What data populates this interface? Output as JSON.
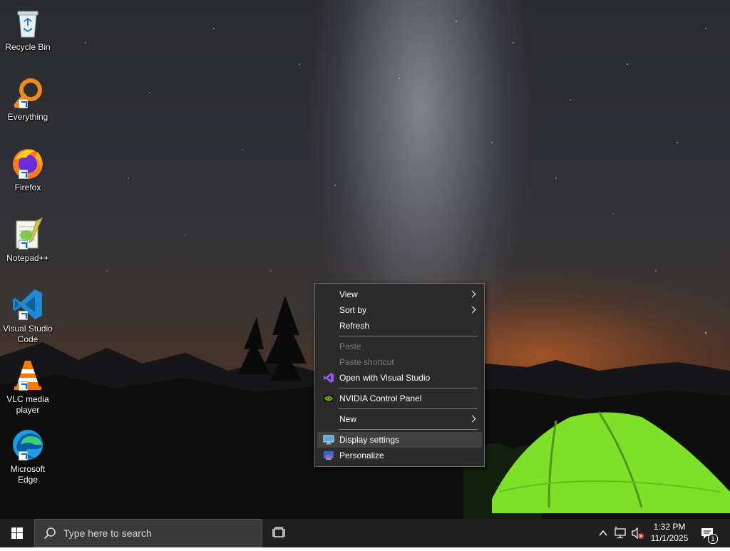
{
  "desktop": {
    "icons": [
      {
        "label": "Recycle Bin",
        "icon": "recycle-bin-icon"
      },
      {
        "label": "Everything",
        "icon": "everything-search-icon"
      },
      {
        "label": "Firefox",
        "icon": "firefox-icon"
      },
      {
        "label": "Notepad++",
        "icon": "notepadpp-icon"
      },
      {
        "label": "Visual Studio Code",
        "icon": "vscode-icon"
      },
      {
        "label": "VLC media player",
        "icon": "vlc-icon"
      },
      {
        "label": "Microsoft Edge",
        "icon": "edge-icon"
      }
    ]
  },
  "context_menu": {
    "items": [
      {
        "label": "View"
      },
      {
        "label": "Sort by"
      },
      {
        "label": "Refresh"
      },
      {
        "label": "Paste"
      },
      {
        "label": "Paste shortcut"
      },
      {
        "label": "Open with Visual Studio"
      },
      {
        "label": "NVIDIA Control Panel"
      },
      {
        "label": "New"
      },
      {
        "label": "Display settings"
      },
      {
        "label": "Personalize"
      }
    ]
  },
  "taskbar": {
    "search_placeholder": "Type here to search",
    "clock_time": "1:32 PM",
    "clock_date": "11/1/2025",
    "notification_count": "1"
  },
  "colors": {
    "taskbar_bg": "#202020",
    "menu_bg": "#2b2b2b",
    "menu_highlight": "#414141",
    "tent_green": "#7fe02a"
  }
}
